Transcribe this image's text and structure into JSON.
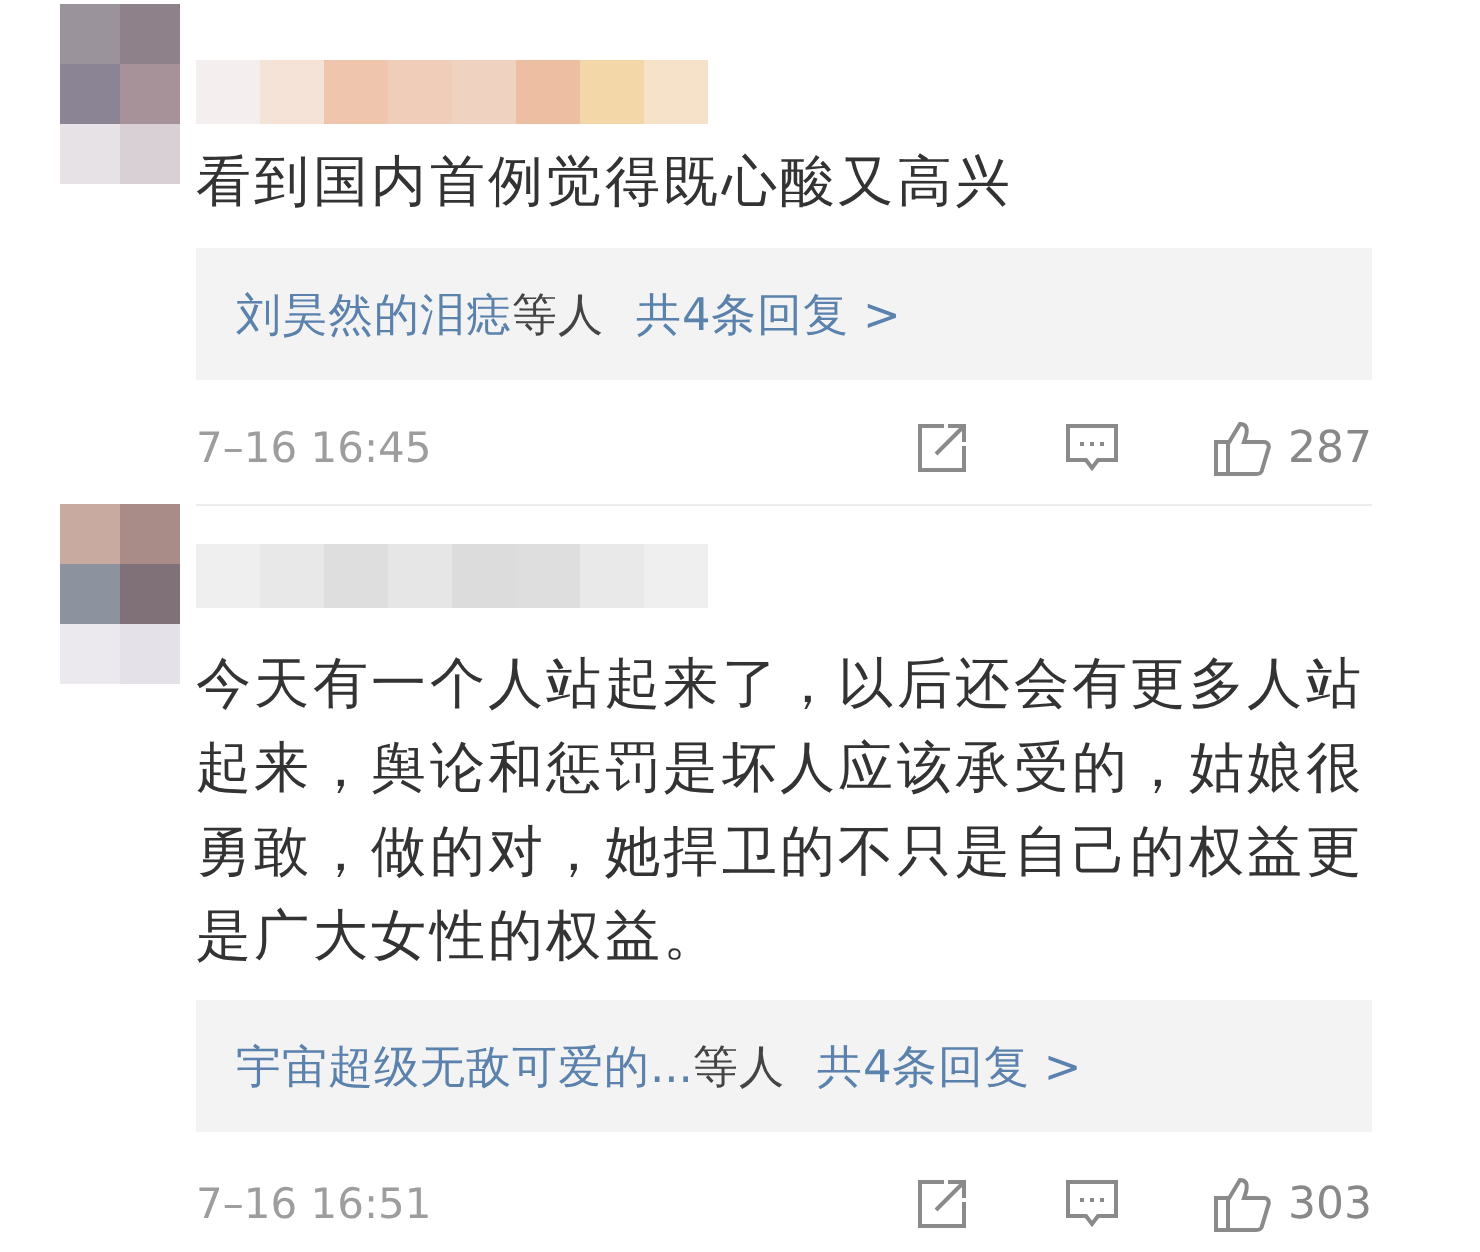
{
  "comments": [
    {
      "text": "看到国内首例觉得既心酸又高兴",
      "replies": {
        "names": "刘昊然的泪痣",
        "others": "等人",
        "count": "共4条回复 >"
      },
      "time": "7–16 16:45",
      "likes": "287"
    },
    {
      "text": "今天有一个人站起来了，以后还会有更多人站起来，舆论和惩罚是坏人应该承受的，姑娘很勇敢，做的对，她捍卫的不只是自己的权益更是广大女性的权益。",
      "replies": {
        "names": "宇宙超级无敌可爱的...",
        "others": "等人",
        "count": "共4条回复 >"
      },
      "time": "7–16 16:51",
      "likes": "303"
    }
  ]
}
